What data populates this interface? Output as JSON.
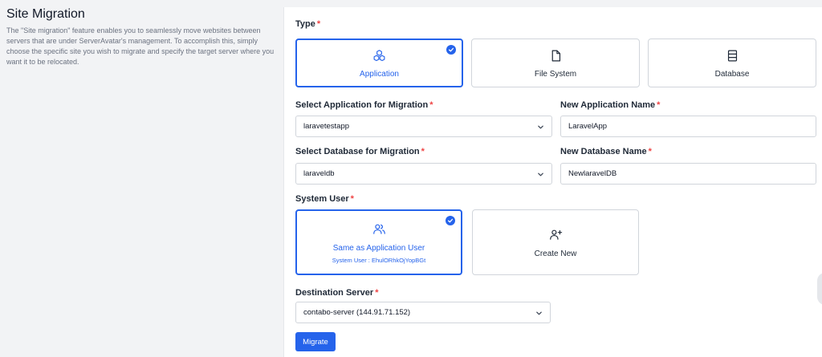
{
  "intro": {
    "title": "Site Migration",
    "description": "The \"Site migration\" feature enables you to seamlessly move websites between servers that are under ServerAvatar's management. To accomplish this, simply choose the specific site you wish to migrate and specify the target server where you want it to be relocated."
  },
  "form": {
    "required_mark": "*",
    "type": {
      "label": "Type",
      "options": [
        {
          "label": "Application",
          "icon": "cubes-icon",
          "selected": true
        },
        {
          "label": "File System",
          "icon": "file-icon",
          "selected": false
        },
        {
          "label": "Database",
          "icon": "database-icon",
          "selected": false
        }
      ]
    },
    "select_application": {
      "label": "Select Application for Migration",
      "value": "laravetestapp"
    },
    "new_application_name": {
      "label": "New Application Name",
      "value": "LaravelApp"
    },
    "select_database": {
      "label": "Select Database for Migration",
      "value": "laraveldb"
    },
    "new_database_name": {
      "label": "New Database Name",
      "value": "NewlaravelDB"
    },
    "system_user": {
      "label": "System User",
      "options": [
        {
          "label": "Same as Application User",
          "sub": "System User :  EhulORhkOjYopBGt",
          "icon": "users-icon",
          "selected": true
        },
        {
          "label": "Create New",
          "icon": "user-plus-icon",
          "selected": false
        }
      ]
    },
    "destination_server": {
      "label": "Destination Server",
      "value": "contabo-server (144.91.71.152)"
    },
    "submit_label": "Migrate"
  },
  "colors": {
    "accent": "#2563eb",
    "required": "#ef4444",
    "border": "#d1d5db"
  }
}
